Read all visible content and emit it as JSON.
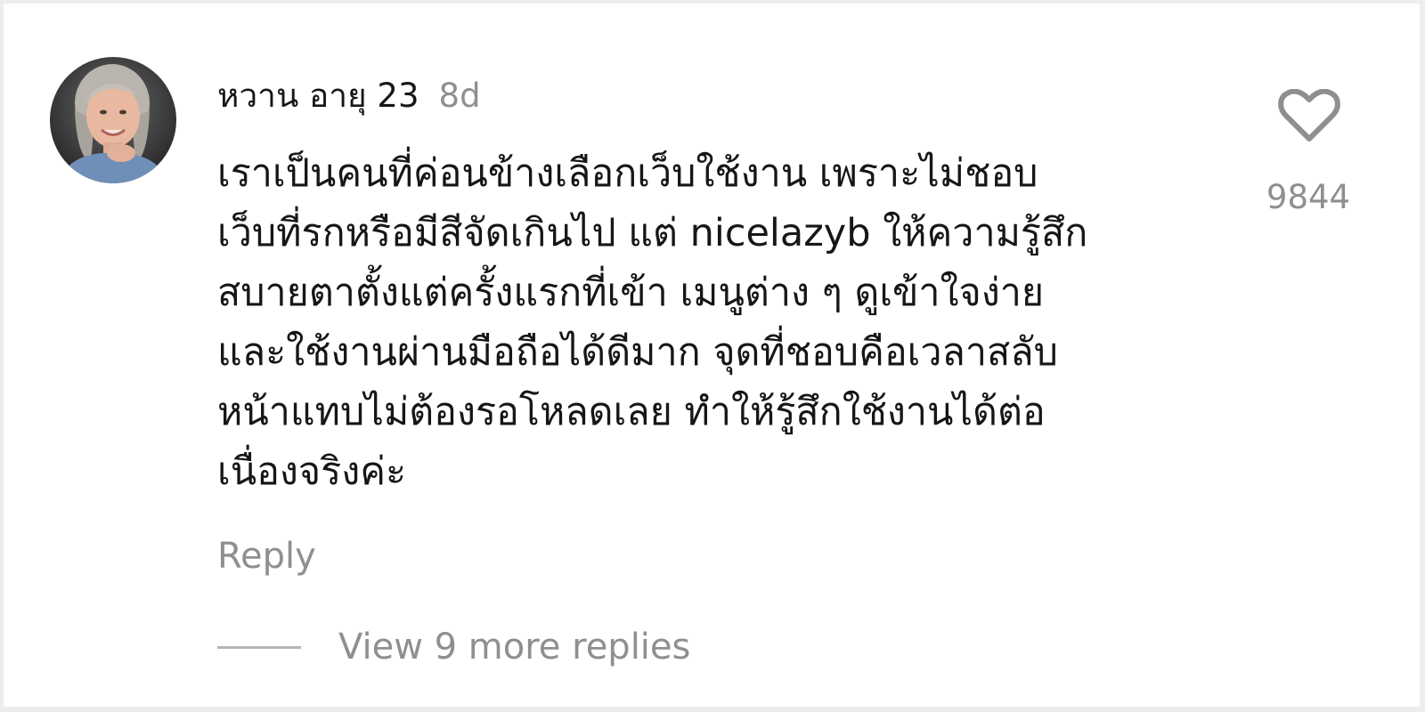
{
  "comment": {
    "author": "หวาน อายุ 23",
    "timestamp": "8d",
    "body_lines": [
      "เราเป็นคนที่ค่อนข้างเลือกเว็บใช้งาน เพราะไม่ชอบ",
      "เว็บที่รกหรือมีสีจัดเกินไป แต่ nicelazyb ให้ความรู้สึก",
      "สบายตาตั้งแต่ครั้งแรกที่เข้า เมนูต่าง ๆ ดูเข้าใจง่าย",
      "และใช้งานผ่านมือถือได้ดีมาก จุดที่ชอบคือเวลาสลับ",
      "หน้าแทบไม่ต้องรอโหลดเลย ทำให้รู้สึกใช้งานได้ต่อ",
      "เนื่องจริงค่ะ"
    ],
    "like_icon": "heart-outline-icon",
    "like_count": "9844",
    "reply_label": "Reply",
    "view_replies_label": "View 9 more replies"
  },
  "colors": {
    "primary_text": "#161616",
    "secondary_text": "#8f8f8f",
    "heart_outline": "#8f8f8f",
    "divider": "#b4b4b4"
  }
}
